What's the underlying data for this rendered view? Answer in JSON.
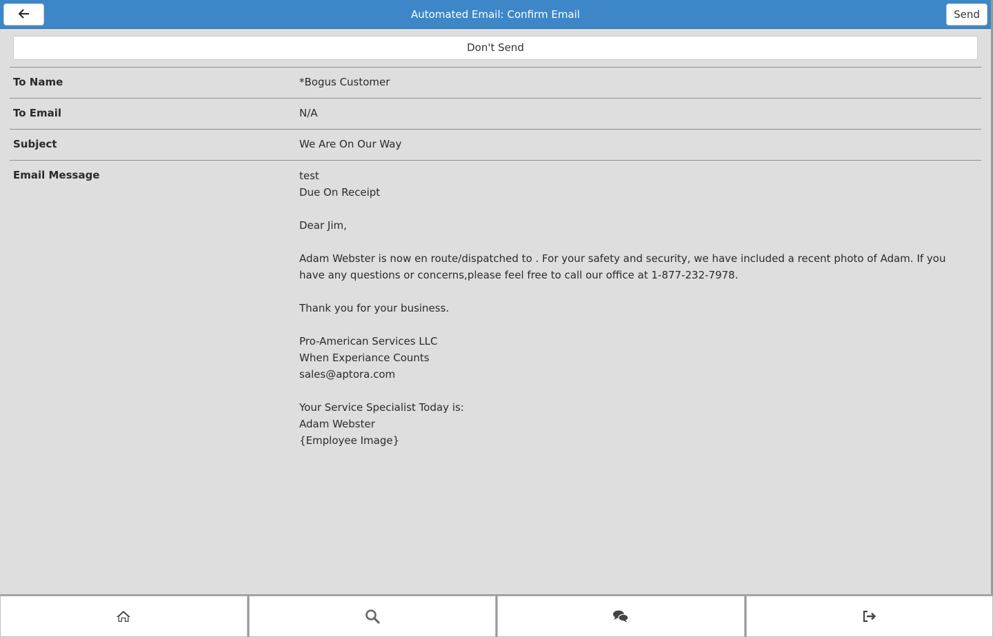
{
  "header": {
    "title": "Automated Email: Confirm Email",
    "back_icon": "arrow-left-icon",
    "send_label": "Send"
  },
  "dont_send_label": "Don't Send",
  "fields": [
    {
      "label": "To Name",
      "value": "*Bogus Customer"
    },
    {
      "label": "To Email",
      "value": "N/A"
    },
    {
      "label": "Subject",
      "value": "We Are On Our Way"
    }
  ],
  "email_message": {
    "label": "Email Message",
    "line1": "test",
    "line2": "Due On Receipt",
    "greeting": "Dear Jim,",
    "body": "Adam Webster is now en route/dispatched to . For your safety and security, we have included a recent photo of Adam. If you have any questions or concerns,please feel free to call our office at 1-877-232-7978.",
    "thanks": "Thank you for your business.",
    "company": "Pro-American Services LLC",
    "tagline": "When Experiance Counts",
    "email": "sales@aptora.com",
    "specialist_intro": "Your Service Specialist Today is:",
    "specialist_name": "Adam Webster",
    "image_placeholder": "{Employee Image}"
  },
  "bottom_nav": {
    "items": [
      {
        "icon": "home-icon"
      },
      {
        "icon": "search-icon"
      },
      {
        "icon": "chat-icon"
      },
      {
        "icon": "logout-icon"
      }
    ]
  },
  "colors": {
    "header": "#3d87c8",
    "background": "#dedede"
  }
}
